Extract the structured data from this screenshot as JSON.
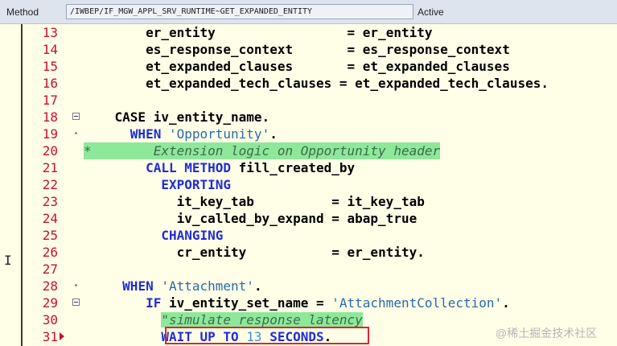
{
  "header": {
    "label": "Method",
    "path": "/IWBEP/IF_MGW_APPL_SRV_RUNTIME~GET_EXPANDED_ENTITY",
    "status": "Active"
  },
  "lines": [
    {
      "n": "13",
      "seg": [
        [
          "sp",
          "        "
        ],
        [
          "id",
          "er_entity"
        ],
        [
          "sp",
          "                 "
        ],
        [
          "id",
          "= er_entity"
        ]
      ]
    },
    {
      "n": "14",
      "seg": [
        [
          "sp",
          "        "
        ],
        [
          "id",
          "es_response_context"
        ],
        [
          "sp",
          "       "
        ],
        [
          "id",
          "= es_response_context"
        ]
      ]
    },
    {
      "n": "15",
      "seg": [
        [
          "sp",
          "        "
        ],
        [
          "id",
          "et_expanded_clauses"
        ],
        [
          "sp",
          "       "
        ],
        [
          "id",
          "= et_expanded_clauses"
        ]
      ]
    },
    {
      "n": "16",
      "seg": [
        [
          "sp",
          "        "
        ],
        [
          "id",
          "et_expanded_tech_clauses"
        ],
        [
          "sp",
          " "
        ],
        [
          "id",
          "= et_expanded_tech_clauses."
        ]
      ]
    },
    {
      "n": "17",
      "seg": []
    },
    {
      "n": "18",
      "fold": "box",
      "seg": [
        [
          "sp",
          "    "
        ],
        [
          "id",
          "CASE iv_entity_name."
        ]
      ]
    },
    {
      "n": "19",
      "fold": "dot",
      "seg": [
        [
          "sp",
          "      "
        ],
        [
          "kw",
          "WHEN"
        ],
        [
          "id",
          " "
        ],
        [
          "str",
          "'Opportunity'"
        ],
        [
          "id",
          "."
        ]
      ]
    },
    {
      "n": "20",
      "hlc": true,
      "seg": [
        [
          "cmt",
          "*        Extension logic on Opportunity header"
        ]
      ]
    },
    {
      "n": "21",
      "seg": [
        [
          "sp",
          "        "
        ],
        [
          "kw",
          "CALL METHOD"
        ],
        [
          "id",
          " fill_created_by"
        ]
      ]
    },
    {
      "n": "22",
      "seg": [
        [
          "sp",
          "          "
        ],
        [
          "kw",
          "EXPORTING"
        ]
      ]
    },
    {
      "n": "23",
      "seg": [
        [
          "sp",
          "            "
        ],
        [
          "id",
          "it_key_tab"
        ],
        [
          "sp",
          "          "
        ],
        [
          "id",
          "= it_key_tab"
        ]
      ]
    },
    {
      "n": "24",
      "seg": [
        [
          "sp",
          "            "
        ],
        [
          "id",
          "iv_called_by_expand = abap_true"
        ]
      ]
    },
    {
      "n": "25",
      "seg": [
        [
          "sp",
          "          "
        ],
        [
          "kw",
          "CHANGING"
        ]
      ]
    },
    {
      "n": "26",
      "seg": [
        [
          "sp",
          "            "
        ],
        [
          "id",
          "cr_entity"
        ],
        [
          "sp",
          "           "
        ],
        [
          "id",
          "= er_entity."
        ]
      ]
    },
    {
      "n": "27",
      "seg": []
    },
    {
      "n": "28",
      "fold": "dot",
      "seg": [
        [
          "sp",
          "     "
        ],
        [
          "kw",
          "WHEN"
        ],
        [
          "id",
          " "
        ],
        [
          "str",
          "'Attachment'"
        ],
        [
          "id",
          "."
        ]
      ]
    },
    {
      "n": "29",
      "fold": "box",
      "seg": [
        [
          "sp",
          "        "
        ],
        [
          "kw",
          "IF"
        ],
        [
          "id",
          " iv_entity_set_name = "
        ],
        [
          "str",
          "'AttachmentCollection'"
        ],
        [
          "id",
          "."
        ]
      ]
    },
    {
      "n": "30",
      "seg": [
        [
          "sp",
          "          "
        ],
        [
          "cmth",
          "\"simulate response latency"
        ]
      ]
    },
    {
      "n": "31",
      "arrow": true,
      "seg": [
        [
          "sp",
          "          "
        ],
        [
          "kw",
          "WAIT UP TO"
        ],
        [
          "id",
          " "
        ],
        [
          "num",
          "13"
        ],
        [
          "id",
          " "
        ],
        [
          "kw",
          "SECONDS"
        ],
        [
          "id",
          "."
        ]
      ]
    }
  ],
  "watermark": "@稀土掘金技术社区"
}
